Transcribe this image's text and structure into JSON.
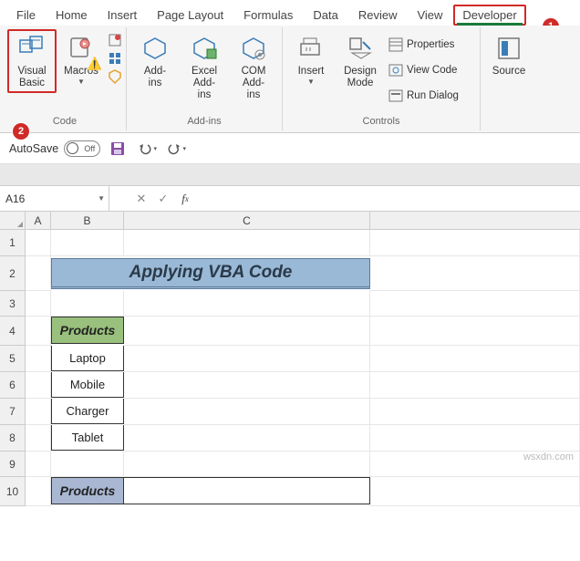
{
  "tabs": [
    "File",
    "Home",
    "Insert",
    "Page Layout",
    "Formulas",
    "Data",
    "Review",
    "View",
    "Developer"
  ],
  "ribbon": {
    "code": {
      "visual_basic": "Visual Basic",
      "macros": "Macros",
      "group": "Code"
    },
    "addins": {
      "addins": "Add-ins",
      "excel_addins": "Excel Add-ins",
      "com_addins": "COM Add-ins",
      "group": "Add-ins"
    },
    "controls": {
      "insert": "Insert",
      "design_mode": "Design Mode",
      "properties": "Properties",
      "view_code": "View Code",
      "run_dialog": "Run Dialog",
      "group": "Controls"
    },
    "xml": {
      "source": "Source"
    }
  },
  "qat": {
    "autosave": "AutoSave",
    "toggle": "Off"
  },
  "namebox": "A16",
  "callouts": {
    "tab": "1",
    "vb": "2"
  },
  "sheet": {
    "cols": [
      "A",
      "B",
      "C"
    ],
    "rows": [
      "1",
      "2",
      "3",
      "4",
      "5",
      "6",
      "7",
      "8",
      "9",
      "10"
    ],
    "title": "Applying VBA Code",
    "header1": "Products",
    "items": [
      "Laptop",
      "Mobile",
      "Charger",
      "Tablet"
    ],
    "header2": "Products"
  },
  "watermark": "wsxdn.com"
}
